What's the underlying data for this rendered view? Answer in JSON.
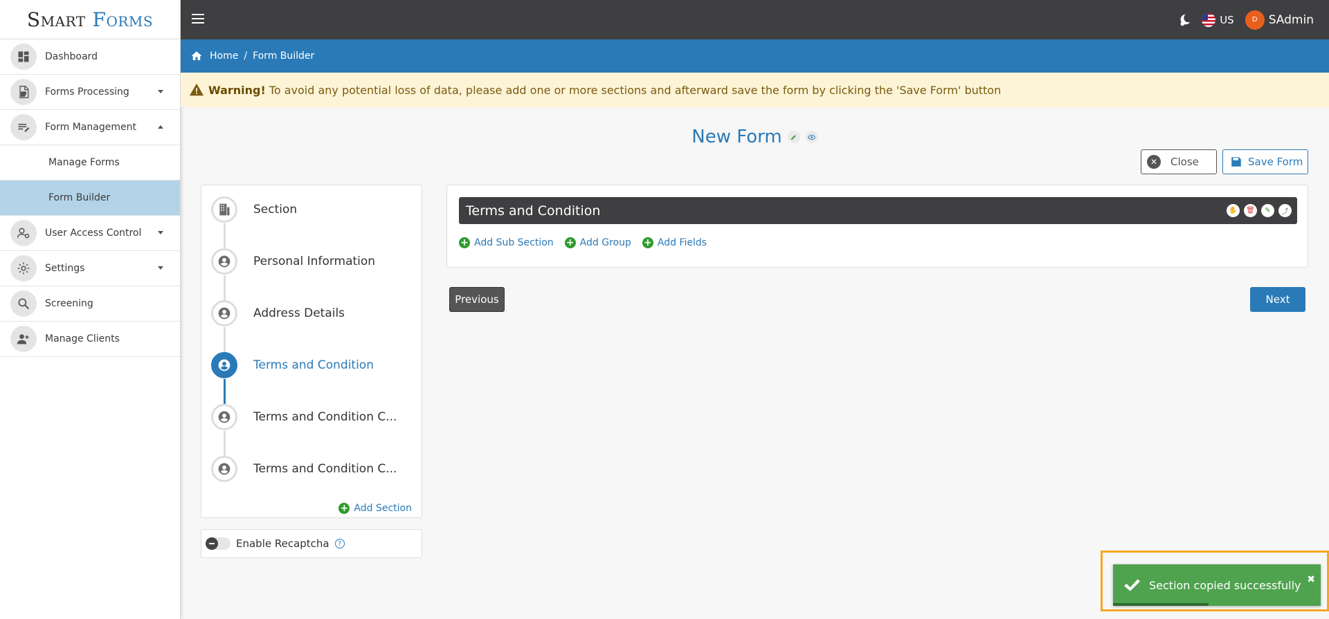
{
  "app": {
    "logo_part1": "Smart",
    "logo_part2": "Forms"
  },
  "sidebar": {
    "items": [
      {
        "label": "Dashboard"
      },
      {
        "label": "Forms Processing"
      },
      {
        "label": "Form Management"
      },
      {
        "label": "Manage Forms"
      },
      {
        "label": "Form Builder"
      },
      {
        "label": "User Access Control"
      },
      {
        "label": "Settings"
      },
      {
        "label": "Screening"
      },
      {
        "label": "Manage Clients"
      }
    ]
  },
  "topbar": {
    "language": "US",
    "avatar_initial": "D",
    "username": "SAdmin"
  },
  "breadcrumb": {
    "home": "Home",
    "separator": "/",
    "current": "Form Builder"
  },
  "warning": {
    "title": "Warning!",
    "text": "To avoid any potential loss of data, please add one or more sections and afterward save the form by clicking the 'Save Form' button"
  },
  "form": {
    "title": "New Form",
    "close_label": "Close",
    "save_label": "Save Form"
  },
  "steps": [
    {
      "label": "Section"
    },
    {
      "label": "Personal Information"
    },
    {
      "label": "Address Details"
    },
    {
      "label": "Terms and Condition"
    },
    {
      "label": "Terms and Condition C..."
    },
    {
      "label": "Terms and Condition C..."
    }
  ],
  "active_step": 3,
  "add_section_label": "Add Section",
  "recaptcha_label": "Enable Recaptcha",
  "section": {
    "title": "Terms and Condition",
    "add_subsection": "Add Sub Section",
    "add_group": "Add Group",
    "add_fields": "Add Fields"
  },
  "nav": {
    "previous": "Previous",
    "next": "Next"
  },
  "toast": {
    "message": "Section copied successfully",
    "close": "✖",
    "progress": 0.46
  },
  "colors": {
    "primary": "#2a7ab8",
    "topbar": "#3f3f42",
    "success": "#4fa34f",
    "warning_bg": "#fdf4d7"
  }
}
